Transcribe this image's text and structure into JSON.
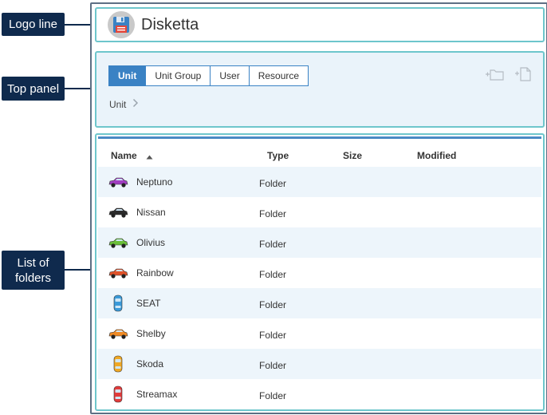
{
  "callouts": {
    "logo_line": "Logo line",
    "top_panel": "Top panel",
    "list_of_folders": "List of folders"
  },
  "app": {
    "title": "Disketta",
    "icon": "floppy-disk-icon"
  },
  "tabs": [
    {
      "label": "Unit",
      "active": true
    },
    {
      "label": "Unit Group",
      "active": false
    },
    {
      "label": "User",
      "active": false
    },
    {
      "label": "Resource",
      "active": false
    }
  ],
  "breadcrumb": {
    "label": "Unit"
  },
  "panel_actions": [
    "new-folder-icon",
    "new-file-icon"
  ],
  "columns": {
    "name": "Name",
    "type": "Type",
    "size": "Size",
    "modified": "Modified"
  },
  "rows": [
    {
      "name": "Neptuno",
      "type": "Folder",
      "car_color": "#a23fc2"
    },
    {
      "name": "Nissan",
      "type": "Folder",
      "car_color": "#2b2b2b"
    },
    {
      "name": "Olivius",
      "type": "Folder",
      "car_color": "#6bbf3a"
    },
    {
      "name": "Rainbow",
      "type": "Folder",
      "car_color": "#e0532a"
    },
    {
      "name": "SEAT",
      "type": "Folder",
      "car_color": "#3a9ad9"
    },
    {
      "name": "Shelby",
      "type": "Folder",
      "car_color": "#f08a24"
    },
    {
      "name": "Skoda",
      "type": "Folder",
      "car_color": "#f0a824"
    },
    {
      "name": "Streamax",
      "type": "Folder",
      "car_color": "#e23b3b"
    }
  ],
  "colors": {
    "accent": "#3a82c4",
    "panel_border": "#6ec6cc",
    "callout_bg": "#0f2a4d",
    "row_alt": "#edf5fb"
  }
}
